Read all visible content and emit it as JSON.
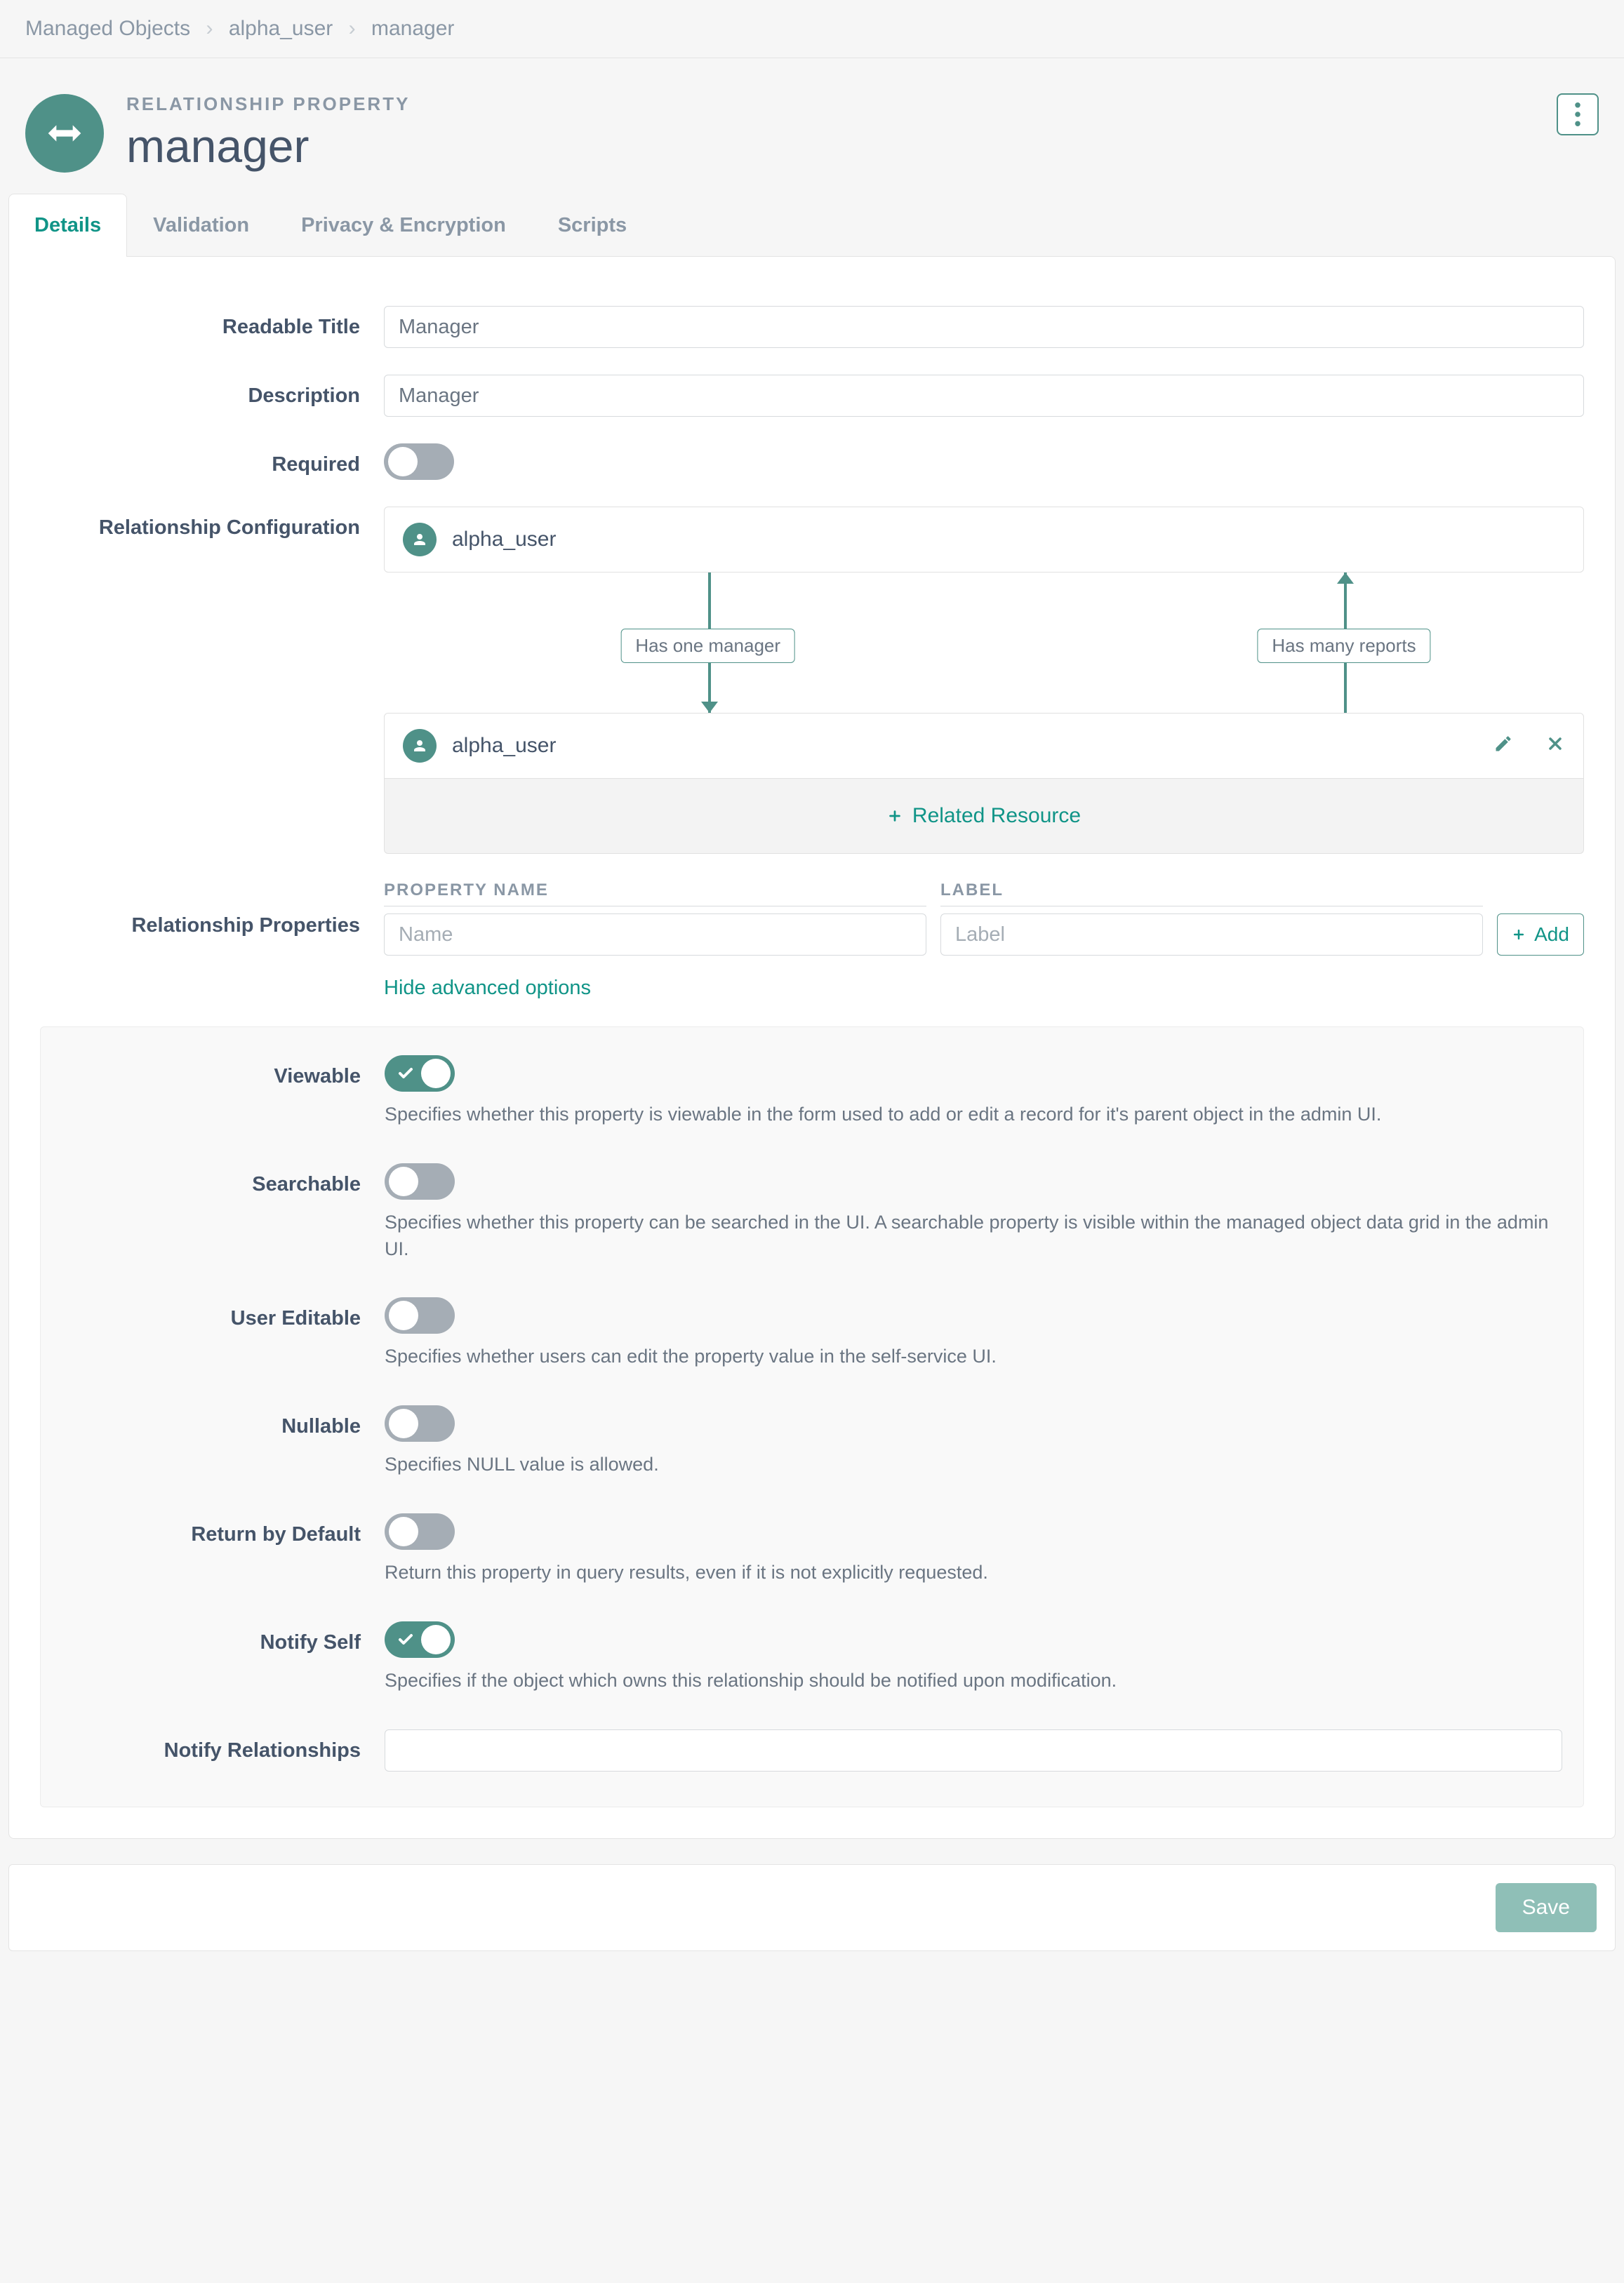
{
  "breadcrumb": {
    "root": "Managed Objects",
    "mid": "alpha_user",
    "leaf": "manager"
  },
  "header": {
    "eyebrow": "RELATIONSHIP PROPERTY",
    "title": "manager"
  },
  "tabs": {
    "details": "Details",
    "validation": "Validation",
    "privacy": "Privacy & Encryption",
    "scripts": "Scripts"
  },
  "labels": {
    "readable_title": "Readable Title",
    "description": "Description",
    "required": "Required",
    "rel_config": "Relationship Configuration",
    "rel_props": "Relationship Properties",
    "viewable": "Viewable",
    "searchable": "Searchable",
    "user_editable": "User Editable",
    "nullable": "Nullable",
    "return_default": "Return by Default",
    "notify_self": "Notify Self",
    "notify_rel": "Notify Relationships"
  },
  "fields": {
    "readable_title": "Manager",
    "description": "Manager",
    "notify_rel": ""
  },
  "rel": {
    "source": "alpha_user",
    "target": "alpha_user",
    "has_one": "Has one manager",
    "has_many": "Has many reports",
    "related_resource": "Related Resource"
  },
  "relprops": {
    "name_header": "PROPERTY NAME",
    "label_header": "LABEL",
    "name_placeholder": "Name",
    "label_placeholder": "Label",
    "add": "Add"
  },
  "adv_link": "Hide advanced options",
  "help": {
    "viewable": "Specifies whether this property is viewable in the form used to add or edit a record for it's parent object in the admin UI.",
    "searchable": "Specifies whether this property can be searched in the UI. A searchable property is visible within the managed object data grid in the admin UI.",
    "user_editable": "Specifies whether users can edit the property value in the self-service UI.",
    "nullable": "Specifies NULL value is allowed.",
    "return_default": "Return this property in query results, even if it is not explicitly requested.",
    "notify_self": "Specifies if the object which owns this relationship should be notified upon modification."
  },
  "footer": {
    "save": "Save"
  },
  "toggles": {
    "required": false,
    "viewable": true,
    "searchable": false,
    "user_editable": false,
    "nullable": false,
    "return_default": false,
    "notify_self": true
  }
}
